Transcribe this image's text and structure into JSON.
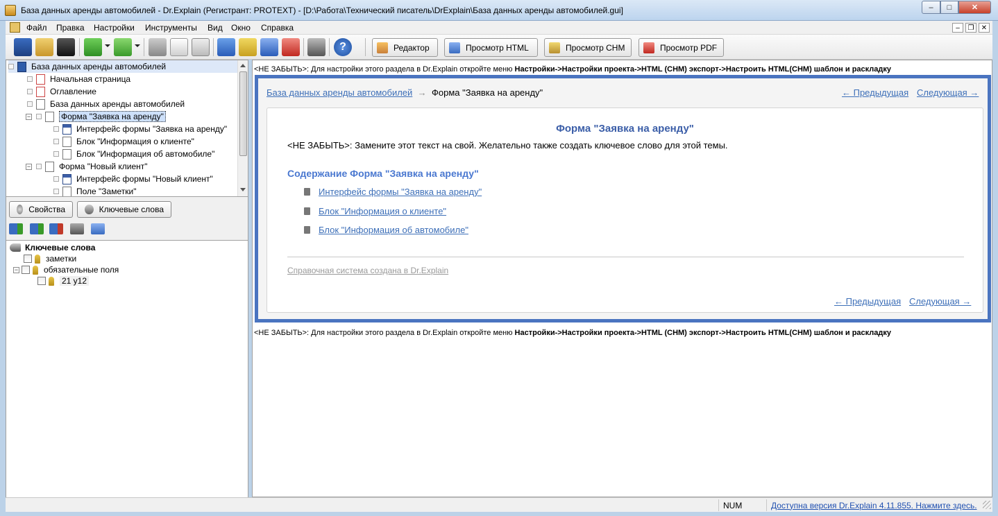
{
  "window": {
    "title": "База данных аренды автомобилей - Dr.Explain (Регистрант: PROTEXT) - [D:\\Работа\\Технический писатель\\DrExplain\\База данных аренды автомобилей.gui]",
    "min_glyph": "–",
    "max_glyph": "□",
    "close_glyph": "✕"
  },
  "menu": {
    "items": [
      "Файл",
      "Правка",
      "Настройки",
      "Инструменты",
      "Вид",
      "Окно",
      "Справка"
    ],
    "mdi": [
      "–",
      "❐",
      "✕"
    ]
  },
  "toolbar": {
    "icons": [
      "project-icon",
      "open-icon",
      "save-icon",
      "add-topic-icon",
      "add-child-icon",
      "cut-icon",
      "copy-icon",
      "paste-icon",
      "export-html-icon",
      "export-chm-icon",
      "export-rtf-icon",
      "export-pdf-icon",
      "settings-icon",
      "help-icon"
    ],
    "help_glyph": "?",
    "buttons": [
      "Редактор",
      "Просмотр HTML",
      "Просмотр CHM",
      "Просмотр PDF"
    ]
  },
  "tree": {
    "items": [
      {
        "label": "База данных аренды автомобилей"
      },
      {
        "label": "Начальная страница"
      },
      {
        "label": "Оглавление"
      },
      {
        "label": "База данных аренды автомобилей"
      },
      {
        "label": "Форма \"Заявка на аренду\""
      },
      {
        "label": "Интерфейс формы \"Заявка на аренду\""
      },
      {
        "label": "Блок \"Информация о клиенте\""
      },
      {
        "label": "Блок \"Информация об автомобиле\""
      },
      {
        "label": "Форма \"Новый клиент\""
      },
      {
        "label": "Интерфейс формы \"Новый клиент\""
      },
      {
        "label": "Поле \"Заметки\""
      }
    ],
    "expand_glyph": "−"
  },
  "panel_tabs": [
    "Свойства",
    "Ключевые слова"
  ],
  "keywords": {
    "root": "Ключевые слова",
    "items": [
      "заметки",
      "обязательные поля",
      "21 у12"
    ]
  },
  "content": {
    "notice_prefix": "<НЕ ЗАБЫТЬ>: Для настройки этого раздела в Dr.Explain откройте меню ",
    "notice_path": "Настройки->Настройки проекта->HTML (CHM) экспорт->Настроить HTML(CHM) шаблон и раскладку",
    "breadcrumb_link": "База данных аренды автомобилей",
    "breadcrumb_arrow": "→",
    "breadcrumb_current": "Форма \"Заявка на аренду\"",
    "prev": "← Предыдущая",
    "next": "Следующая →",
    "title": "Форма \"Заявка на аренду\"",
    "text": "<НЕ ЗАБЫТЬ>: Замените этот текст на свой. Желательно также создать ключевое слово для этой темы.",
    "toc_heading": "Содержание Форма \"Заявка на аренду\"",
    "toc_items": [
      "Интерфейс формы \"Заявка на аренду\"",
      "Блок \"Информация о клиенте\"",
      "Блок \"Информация об автомобиле\""
    ],
    "footer": "Справочная система создана в Dr.Explain"
  },
  "status": {
    "num": "NUM",
    "update_link": "Доступна версия Dr.Explain 4.11.855. Нажмите здесь."
  }
}
